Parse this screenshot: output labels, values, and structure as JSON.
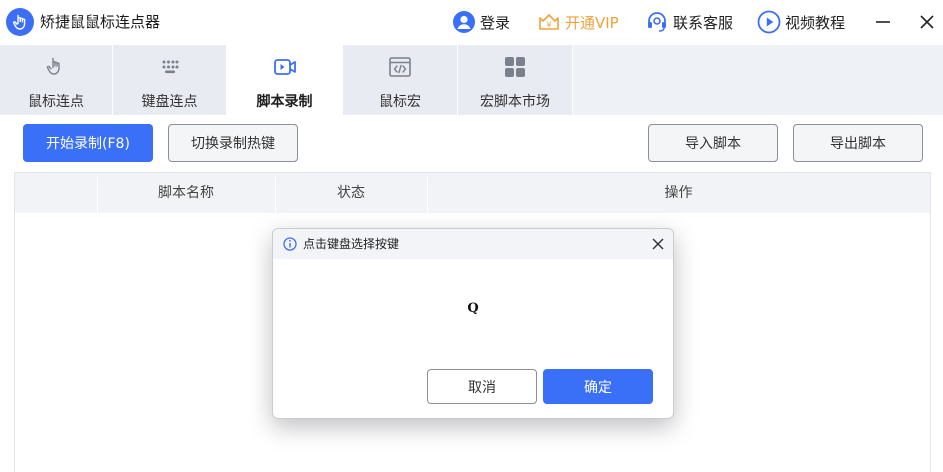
{
  "app": {
    "title": "矫捷鼠鼠标连点器"
  },
  "titlebar": {
    "login": "登录",
    "vip": "开通VIP",
    "service": "联系客服",
    "video": "视频教程"
  },
  "tabs": [
    {
      "label": "鼠标连点",
      "icon": "pointer-hand-icon"
    },
    {
      "label": "键盘连点",
      "icon": "keyboard-icon"
    },
    {
      "label": "脚本录制",
      "icon": "video-record-icon",
      "active": true
    },
    {
      "label": "鼠标宏",
      "icon": "code-window-icon"
    },
    {
      "label": "宏脚本市场",
      "icon": "grid-market-icon"
    }
  ],
  "toolbar": {
    "record": "开始录制(F8)",
    "hotkey": "切换录制热键",
    "import": "导入脚本",
    "export": "导出脚本"
  },
  "table": {
    "columns": [
      "脚本名称",
      "状态",
      "操作"
    ]
  },
  "dialog": {
    "title": "点击键盘选择按键",
    "key": "Q",
    "cancel": "取消",
    "confirm": "确定"
  },
  "colors": {
    "accent": "#3a6ff7",
    "vip": "#f0a23a",
    "tab_bg": "#e8ebf1"
  }
}
